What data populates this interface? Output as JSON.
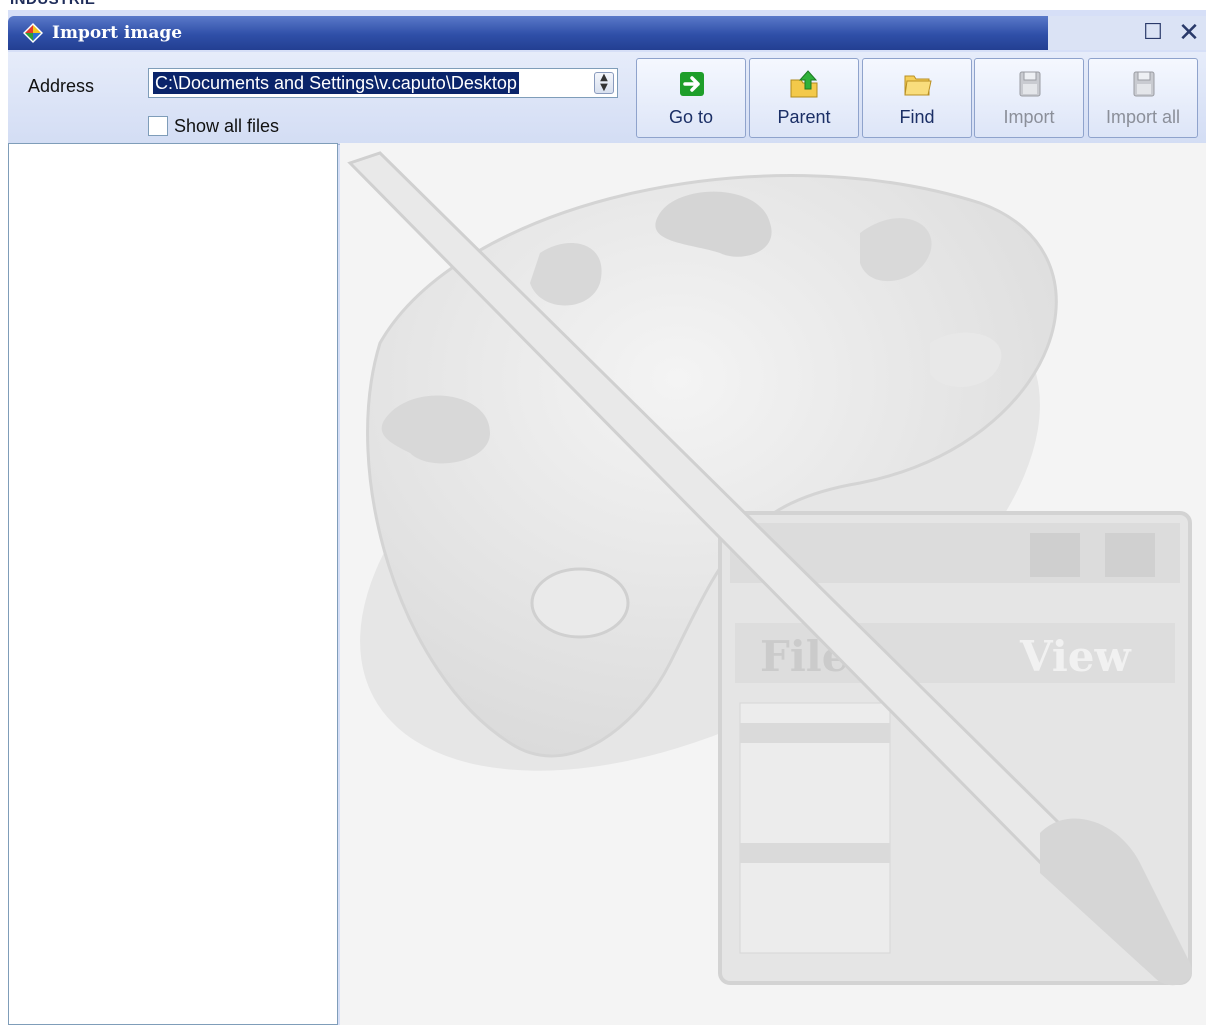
{
  "header_text": "INDUSTRIE",
  "window": {
    "title": "Import image",
    "maximize_glyph": "☐",
    "close_glyph": "✕"
  },
  "toolbar": {
    "address_label": "Address",
    "address_value": "C:\\Documents and Settings\\v.caputo\\Desktop",
    "show_all_label": "Show all files",
    "show_all_checked": false,
    "buttons": [
      {
        "label": "Go to",
        "icon": "green-arrow-right-icon",
        "enabled": true
      },
      {
        "label": "Parent",
        "icon": "folder-up-arrow-icon",
        "enabled": true
      },
      {
        "label": "Find",
        "icon": "folder-search-icon",
        "enabled": true
      },
      {
        "label": "Import",
        "icon": "floppy-disk-icon",
        "enabled": false
      },
      {
        "label": "Import all",
        "icon": "floppy-disk-multiple-icon",
        "enabled": false
      }
    ]
  },
  "preview_watermark": {
    "icon": "paint-palette-brush-icon",
    "menu_text_1": "File",
    "menu_text_2": "View"
  },
  "colors": {
    "titlebar": "#2f4fa8",
    "toolbar_bg": "#d6dff7",
    "selection": "#0a246a",
    "go_green": "#1e9e2a"
  }
}
